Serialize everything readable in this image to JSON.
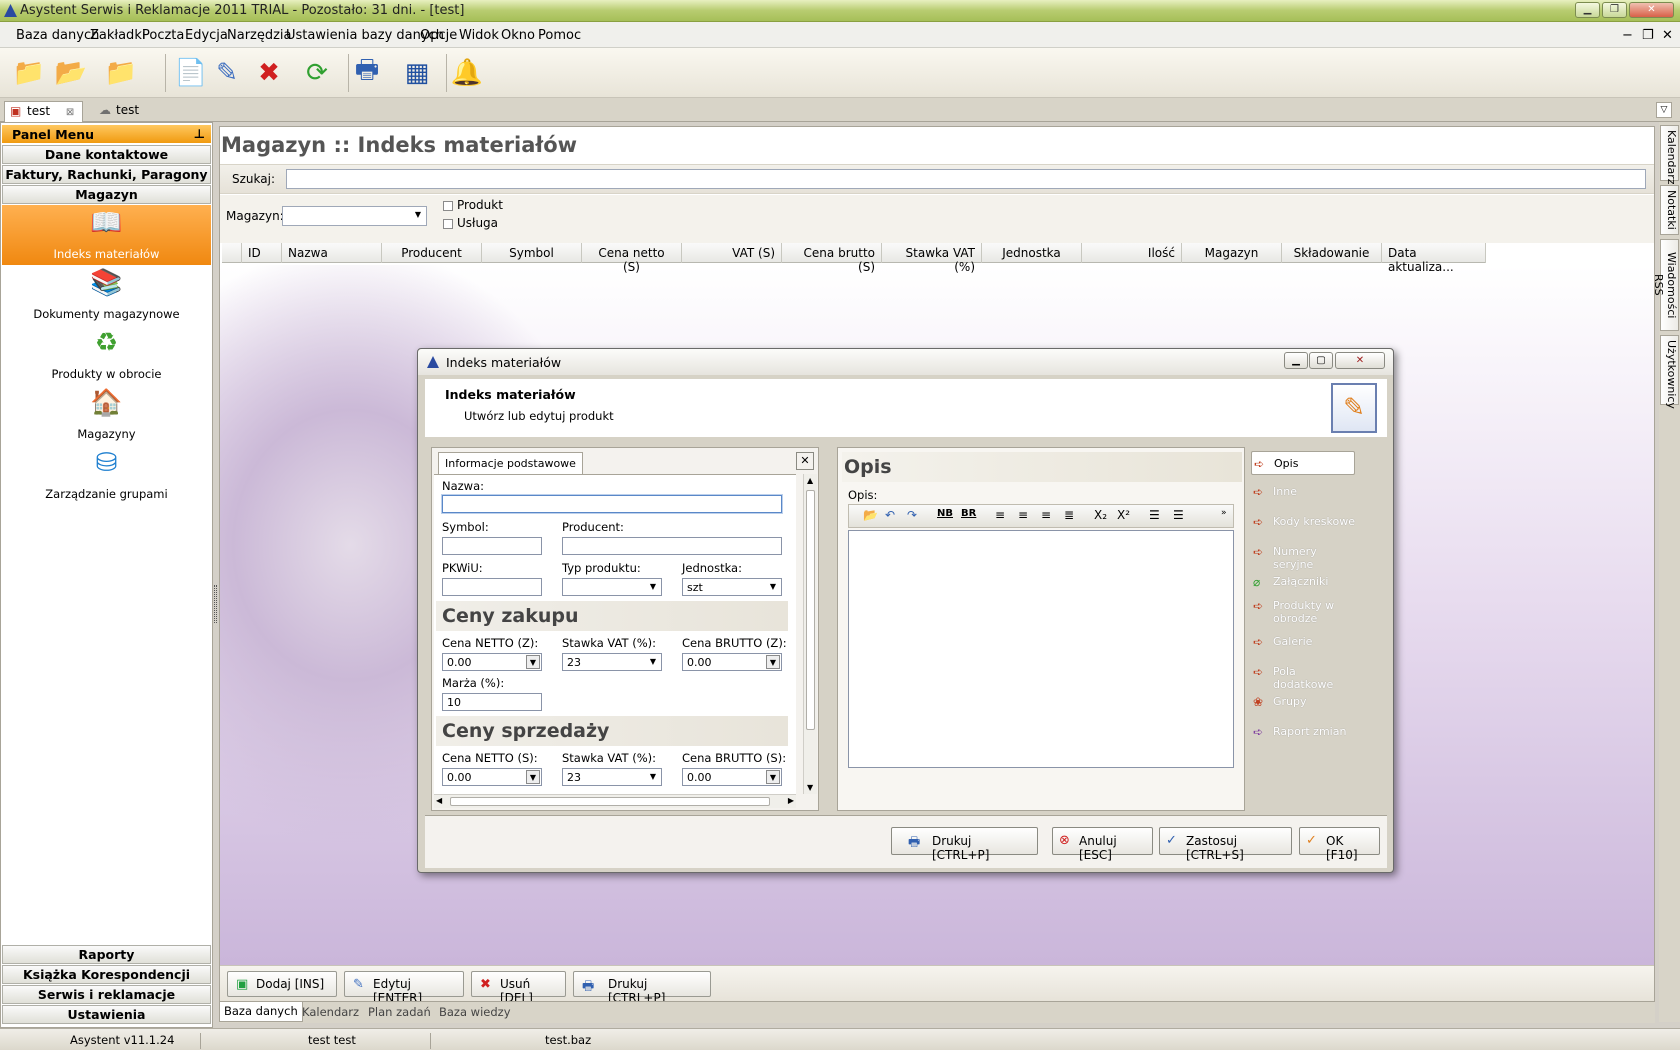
{
  "window": {
    "title": "Asystent Serwis i Reklamacje 2011 TRIAL - Pozostało: 31 dni. - [test]"
  },
  "menu": [
    "Baza danych",
    "Zakładki",
    "Poczta",
    "Edycja",
    "Narzędzia",
    "Ustawienia bazy danych",
    "Opcje",
    "Widok",
    "Okno",
    "Pomoc"
  ],
  "toolbar": {
    "icons": [
      "new-database-icon",
      "open-folder-icon",
      "close-database-icon",
      "add-record-icon",
      "edit-record-icon",
      "delete-record-icon",
      "refresh-icon",
      "print-icon",
      "calculator-icon",
      "bell-icon"
    ]
  },
  "doc_tabs": [
    {
      "label": "test"
    },
    {
      "label": "test"
    }
  ],
  "sidebar": {
    "title": "Panel Menu",
    "top_sections": [
      "Dane kontaktowe",
      "Faktury, Rachunki, Paragony",
      "Magazyn"
    ],
    "items": [
      {
        "label": "Indeks materiałów",
        "icon": "book-icon"
      },
      {
        "label": "Dokumenty magazynowe",
        "icon": "documents-icon"
      },
      {
        "label": "Produkty w obrocie",
        "icon": "recycle-icon"
      },
      {
        "label": "Magazyny",
        "icon": "warehouse-icon"
      },
      {
        "label": "Zarządzanie grupami",
        "icon": "groups-icon"
      }
    ],
    "bottom_sections": [
      "Raporty",
      "Książka Korespondencji",
      "Serwis i reklamacje",
      "Ustawienia"
    ]
  },
  "main": {
    "title": "Magazyn :: Indeks materiałów",
    "search_label": "Szukaj:",
    "search_value": "",
    "warehouse_label": "Magazyn:",
    "warehouse_value": "",
    "checkbox_product": "Produkt",
    "checkbox_service": "Usługa",
    "columns": [
      "ID",
      "Nazwa",
      "Producent",
      "Symbol",
      "Cena netto (S)",
      "VAT (S)",
      "Cena brutto (S)",
      "Stawka VAT (%)",
      "Jednostka",
      "Ilość",
      "Magazyn",
      "Składowanie",
      "Data aktualiza..."
    ],
    "buttons": {
      "add": "Dodaj [INS]",
      "edit": "Edytuj [ENTER]",
      "delete": "Usuń [DEL]",
      "print": "Drukuj [CTRL+P]"
    }
  },
  "bottom_tabs": [
    "Baza danych",
    "Kalendarz",
    "Plan zadań",
    "Baza wiedzy"
  ],
  "right_rail": [
    "Kalendarz",
    "Notatki",
    "Wiadomości RSS",
    "Użytkownicy"
  ],
  "status": {
    "version": "Asystent v11.1.24",
    "user": "test test",
    "file": "test.baz"
  },
  "dialog": {
    "title": "Indeks materiałów",
    "header_title": "Indeks materiałów",
    "header_subtitle": "Utwórz lub edytuj produkt",
    "tab": "Informacje podstawowe",
    "fields": {
      "name_label": "Nazwa:",
      "name_value": "",
      "symbol_label": "Symbol:",
      "symbol_value": "",
      "producer_label": "Producent:",
      "producer_value": "",
      "pkwiu_label": "PKWiU:",
      "pkwiu_value": "",
      "product_type_label": "Typ produktu:",
      "product_type_value": "",
      "unit_label": "Jednostka:",
      "unit_value": "szt"
    },
    "purchase": {
      "heading": "Ceny zakupu",
      "net_label": "Cena NETTO (Z):",
      "net_value": "0.00",
      "vat_label": "Stawka VAT (%):",
      "vat_value": "23",
      "gross_label": "Cena BRUTTO (Z):",
      "gross_value": "0.00",
      "margin_label": "Marża (%):",
      "margin_value": "10"
    },
    "sale": {
      "heading": "Ceny sprzedaży",
      "net_label": "Cena NETTO (S):",
      "net_value": "0.00",
      "vat_label": "Stawka VAT (%):",
      "vat_value": "23",
      "gross_label": "Cena BRUTTO (S):",
      "gross_value": "0.00"
    },
    "opis": {
      "heading": "Opis",
      "label": "Opis:"
    },
    "nav": [
      "Opis",
      "Inne",
      "Kody kreskowe",
      "Numery seryjne",
      "Załączniki",
      "Produkty w obrodze",
      "Galerie",
      "Pola dodatkowe",
      "Grupy",
      "Raport zmian"
    ],
    "buttons": {
      "print": "Drukuj [CTRL+P]",
      "cancel": "Anuluj [ESC]",
      "apply": "Zastosuj [CTRL+S]",
      "ok": "OK [F10]"
    }
  },
  "colors": {
    "accent_orange": "#f09a10",
    "title_green": "#a6bf58",
    "bg_purple": "#c7b2d8"
  }
}
